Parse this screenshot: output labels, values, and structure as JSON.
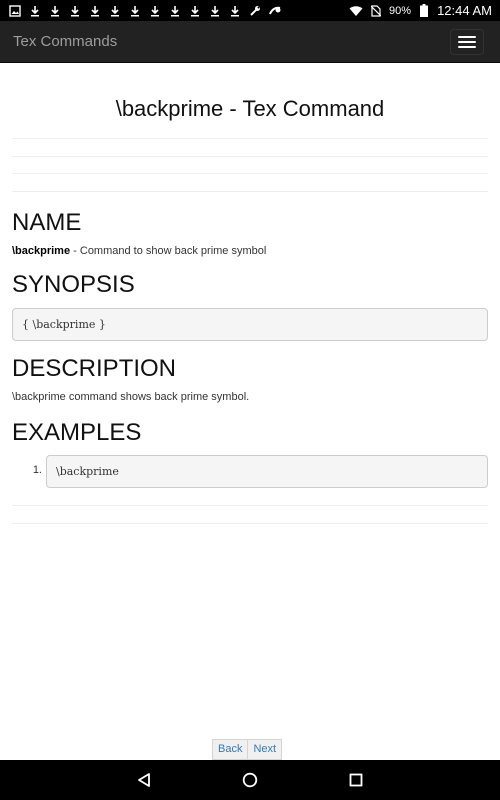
{
  "status_bar": {
    "battery": "90%",
    "time": "12:44 AM",
    "left_icons": [
      "image-icon",
      "download-icon",
      "download-icon",
      "download-icon",
      "download-icon",
      "download-icon",
      "download-icon",
      "download-icon",
      "download-icon",
      "download-icon",
      "download-icon",
      "download-icon",
      "wrench-icon",
      "voicemail-icon"
    ],
    "right_icons": [
      "wifi-icon",
      "no-sim-icon",
      "battery-icon"
    ]
  },
  "app_bar": {
    "title": "Tex Commands",
    "menu_icon": "hamburger-menu-icon"
  },
  "page": {
    "title": "\\backprime - Tex Command",
    "name_heading": "NAME",
    "name_command": "\\backprime",
    "name_desc": " - Command to show back prime symbol",
    "synopsis_heading": "SYNOPSIS",
    "synopsis_code": "{ \\backprime }",
    "description_heading": "DESCRIPTION",
    "description_text": "\\backprime command shows back prime symbol.",
    "examples_heading": "EXAMPLES",
    "examples": [
      {
        "num": "1.",
        "code": "\\backprime"
      }
    ]
  },
  "pager": {
    "back_label": "Back",
    "next_label": "Next"
  },
  "nav_bar": {
    "icons": [
      "back-triangle-icon",
      "home-circle-icon",
      "recents-square-icon"
    ]
  },
  "colors": {
    "app_bar_bg": "#222222",
    "app_title": "#9d9d9d",
    "link": "#337ab7",
    "code_bg": "#f5f5f5"
  }
}
